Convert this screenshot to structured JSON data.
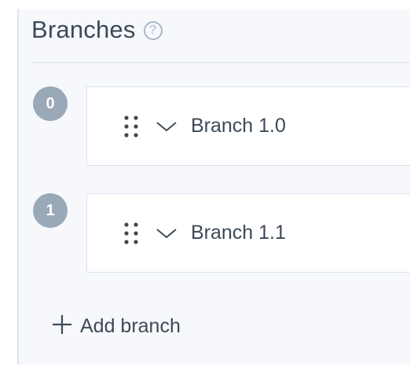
{
  "section": {
    "title": "Branches",
    "help_glyph": "?"
  },
  "branches": [
    {
      "index": "0",
      "label": "Branch 1.0"
    },
    {
      "index": "1",
      "label": "Branch 1.1"
    }
  ],
  "add_branch": {
    "label": "Add branch"
  },
  "icons": {
    "help": "help-icon",
    "drag": "drag-handle-icon",
    "expand": "chevron-down-icon",
    "add": "plus-icon"
  },
  "colors": {
    "panel_bg": "#f7f8fc",
    "badge_bg": "#9aa9b8",
    "text": "#3c4a57",
    "border": "#d7e1ea"
  }
}
